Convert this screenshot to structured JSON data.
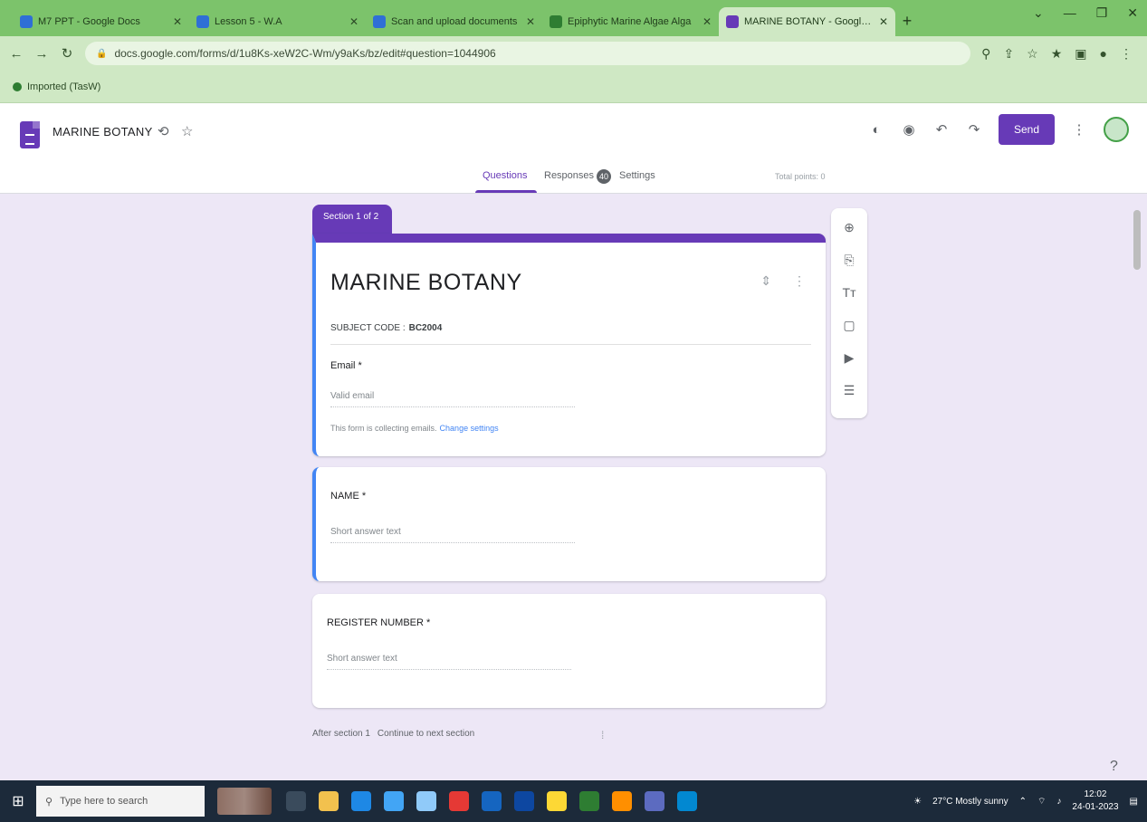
{
  "browser": {
    "tabs": [
      {
        "title": "M7 PPT - Google Docs",
        "active": false
      },
      {
        "title": "Lesson 5 - W.A",
        "active": false
      },
      {
        "title": "Scan and upload documents",
        "active": false
      },
      {
        "title": "Epiphytic Marine Algae Alga",
        "active": false
      },
      {
        "title": "MARINE BOTANY - Google Forms",
        "active": true
      }
    ],
    "new_tab": "+",
    "window_controls": [
      "⌄",
      "—",
      "❐",
      "✕"
    ],
    "url": "docs.google.com/forms/d/1u8Ks-xeW2C-Wm/y9aKs/bz/edit#question=1044906",
    "bookmark": "Imported (TasW)"
  },
  "forms_header": {
    "form_name": "MARINE BOTANY",
    "send_label": "Send",
    "tabs": {
      "questions": "Questions",
      "responses": "Responses",
      "settings": "Settings"
    },
    "responses_count": "40",
    "total_points": "Total points: 0"
  },
  "section_tag": "Section 1 of 2",
  "title_card": {
    "title": "MARINE BOTANY",
    "subject_code_label": "SUBJECT CODE :",
    "subject_code_value": "BC2004",
    "email_label": "Email *",
    "email_placeholder": "Valid email",
    "note": "This form is collecting emails.",
    "note_link": "Change settings"
  },
  "questions": [
    {
      "label": "NAME *",
      "placeholder": "Short answer text"
    },
    {
      "label": "REGISTER NUMBER *",
      "placeholder": "Short answer text"
    }
  ],
  "after_section": {
    "label": "After section 1",
    "value": "Continue to next section"
  },
  "taskbar": {
    "search_placeholder": "Type here to search",
    "weather": "27°C Mostly sunny",
    "time": "12:02",
    "date": "24-01-2023"
  },
  "colors": {
    "accent": "#673ab7",
    "page_bg": "#ede7f6",
    "chrome_green": "#7cc36b",
    "active_question": "#4285f4"
  }
}
